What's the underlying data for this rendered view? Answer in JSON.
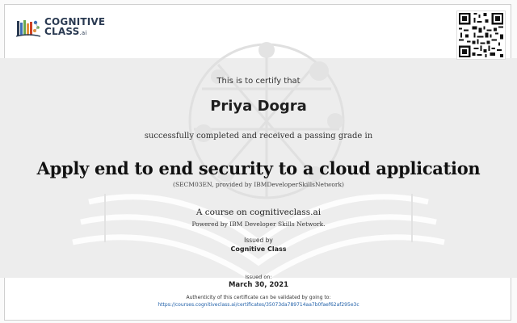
{
  "logo": {
    "line1": "COGNITIVE",
    "line2": "CLASS",
    "suffix": ".ai"
  },
  "certificate": {
    "certify_text": "This is to certify that",
    "recipient_name": "Priya Dogra",
    "completed_text": "successfully completed and received a passing grade in",
    "course_title": "Apply end to end security to a cloud application",
    "course_code": "(SECM03EN, provided by IBMDeveloperSkillsNetwork)",
    "platform_text": "A course on cognitiveclass.ai",
    "powered_by": "Powered by IBM Developer Skills Network.",
    "issued_by_label": "Issued by",
    "issued_by": "Cognitive Class",
    "issued_on_label": "Issued on:",
    "issued_on": "March 30, 2021",
    "authenticity_text": "Authenticity of this certificate can be validated by going to:",
    "validation_url": "https://courses.cognitiveclass.ai/certificates/35073da789714aa7b0faef62af295e3c"
  },
  "colors": {
    "brand_navy": "#2a3a52",
    "link_blue": "#1f5fa8",
    "band_gray": "#ededed"
  },
  "icons": {
    "logo": "books-network-logo",
    "qr": "qr-code"
  }
}
